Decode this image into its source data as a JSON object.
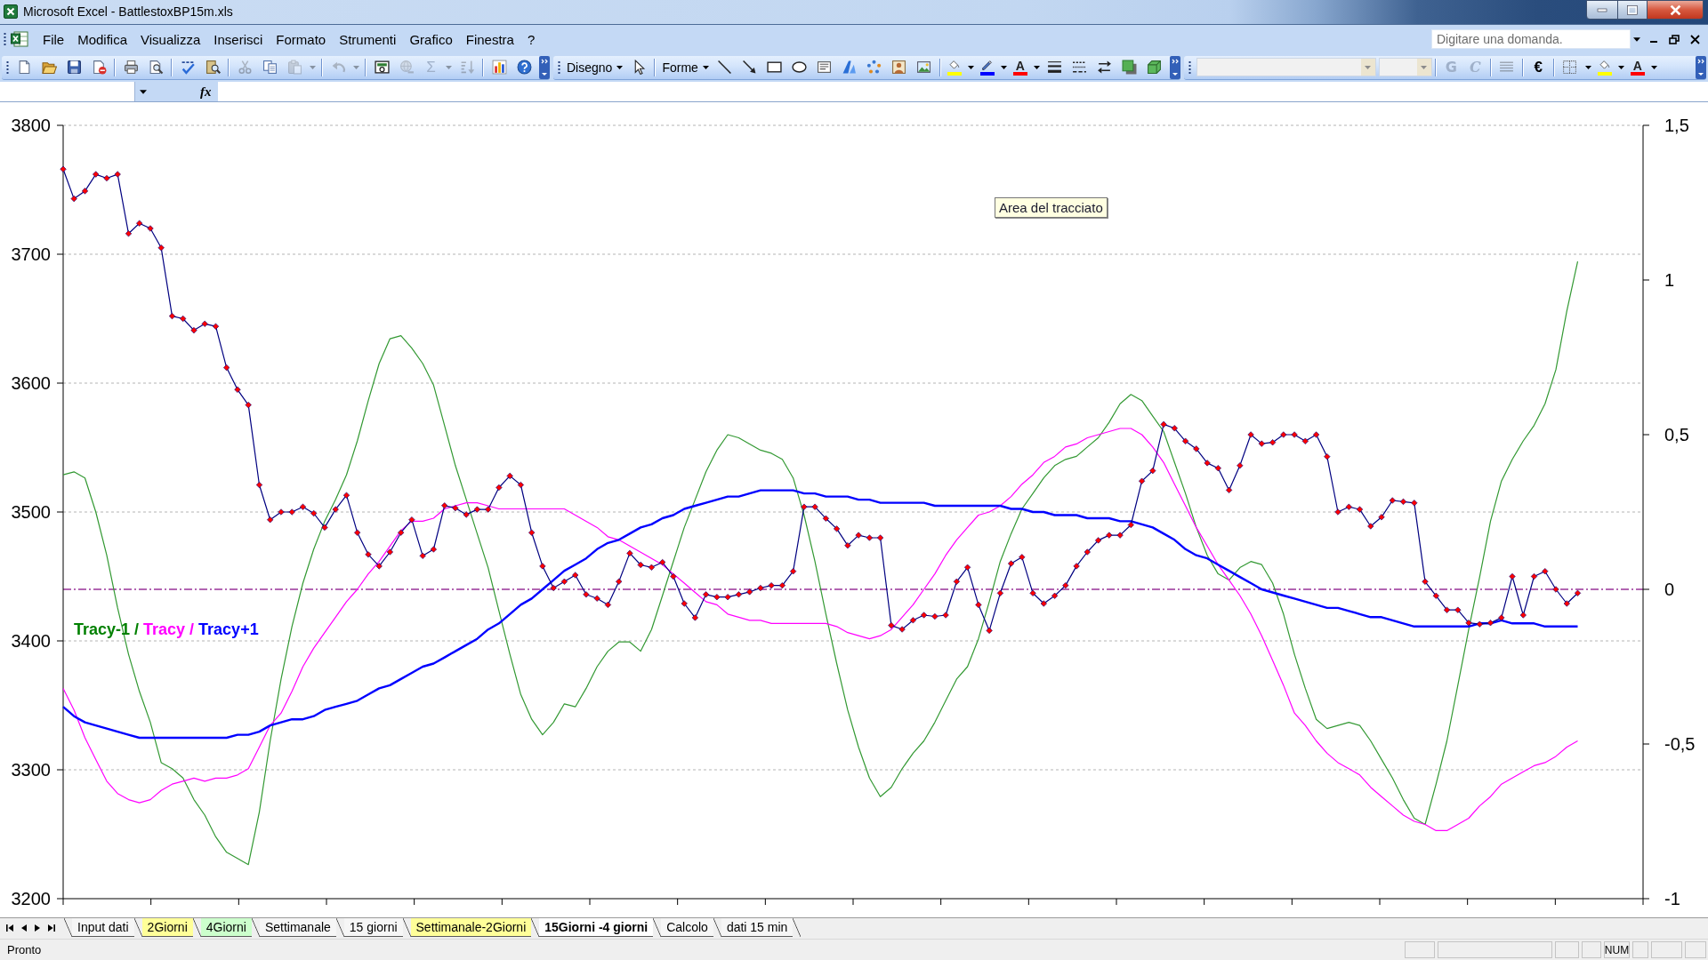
{
  "window": {
    "title": "Microsoft Excel - BattlestoxBP15m.xls"
  },
  "menu_bar": {
    "items": [
      {
        "label": "File"
      },
      {
        "label": "Modifica"
      },
      {
        "label": "Visualizza"
      },
      {
        "label": "Inserisci"
      },
      {
        "label": "Formato"
      },
      {
        "label": "Strumenti"
      },
      {
        "label": "Grafico"
      },
      {
        "label": "Finestra"
      },
      {
        "label": "?"
      }
    ],
    "help_box": {
      "placeholder": "Digitare una domanda."
    }
  },
  "toolbars": [
    {
      "items": [
        {
          "kind": "tool",
          "disabled": false
        },
        {
          "kind": "tool",
          "disabled": false
        },
        {
          "kind": "tool",
          "disabled": false
        },
        {
          "kind": "tool",
          "disabled": false
        },
        {
          "kind": "separator"
        },
        {
          "kind": "tool",
          "disabled": false
        },
        {
          "kind": "tool",
          "disabled": false
        },
        {
          "kind": "separator"
        },
        {
          "kind": "tool",
          "disabled": false
        },
        {
          "kind": "tool",
          "disabled": false
        },
        {
          "kind": "separator"
        },
        {
          "kind": "tool",
          "disabled": true
        },
        {
          "kind": "tool",
          "disabled": false
        },
        {
          "kind": "tool",
          "disabled": true
        },
        {
          "kind": "caret",
          "disabled": true
        },
        {
          "kind": "separator"
        },
        {
          "kind": "tool",
          "disabled": true
        },
        {
          "kind": "caret",
          "disabled": true
        },
        {
          "kind": "separator"
        },
        {
          "kind": "tool",
          "disabled": false
        },
        {
          "kind": "tool",
          "disabled": true
        },
        {
          "kind": "glyph",
          "text": "Σ",
          "disabled": true
        },
        {
          "kind": "caret",
          "disabled": true
        },
        {
          "kind": "tool",
          "disabled": true
        },
        {
          "kind": "separator"
        },
        {
          "kind": "tool",
          "disabled": false
        },
        {
          "kind": "tool",
          "disabled": false
        }
      ]
    },
    {
      "items": [
        {
          "kind": "menu",
          "label": "Disegno"
        },
        {
          "kind": "tool",
          "disabled": false
        },
        {
          "kind": "separator"
        },
        {
          "kind": "menu",
          "label": "Forme"
        },
        {
          "kind": "tool",
          "disabled": false
        },
        {
          "kind": "tool",
          "disabled": false
        },
        {
          "kind": "tool",
          "disabled": false
        },
        {
          "kind": "tool",
          "disabled": false
        },
        {
          "kind": "tool",
          "disabled": false
        },
        {
          "kind": "tool",
          "disabled": false
        },
        {
          "kind": "tool",
          "disabled": false
        },
        {
          "kind": "tool",
          "disabled": false
        },
        {
          "kind": "tool",
          "disabled": false
        },
        {
          "kind": "separator"
        },
        {
          "kind": "color-tool",
          "color": "#ffff00",
          "disabled": false
        },
        {
          "kind": "caret",
          "disabled": false
        },
        {
          "kind": "color-tool",
          "color": "#0000ff",
          "disabled": false
        },
        {
          "kind": "caret",
          "disabled": false
        },
        {
          "kind": "letter-tool",
          "text": "A",
          "color": "#ff0000",
          "disabled": false
        },
        {
          "kind": "caret",
          "disabled": false
        },
        {
          "kind": "tool",
          "disabled": false
        },
        {
          "kind": "tool",
          "disabled": false
        },
        {
          "kind": "tool",
          "disabled": false
        },
        {
          "kind": "tool",
          "disabled": false
        },
        {
          "kind": "tool",
          "disabled": false
        }
      ]
    },
    {
      "items": [
        {
          "kind": "field",
          "disabled": true
        },
        {
          "kind": "field",
          "disabled": true
        },
        {
          "kind": "separator"
        },
        {
          "kind": "bold",
          "text": "G",
          "disabled": true
        },
        {
          "kind": "italic",
          "text": "C",
          "disabled": true
        },
        {
          "kind": "separator"
        },
        {
          "kind": "tool",
          "disabled": true
        },
        {
          "kind": "separator"
        },
        {
          "kind": "glyph",
          "text": "€",
          "disabled": false
        },
        {
          "kind": "separator"
        },
        {
          "kind": "tool",
          "disabled": false
        },
        {
          "kind": "caret",
          "disabled": false
        },
        {
          "kind": "color-tool",
          "color": "#ffff00",
          "disabled": false
        },
        {
          "kind": "caret",
          "disabled": false
        },
        {
          "kind": "letter-tool",
          "text": "A",
          "color": "#ff0000",
          "disabled": false
        },
        {
          "kind": "caret",
          "disabled": false
        }
      ]
    }
  ],
  "formula_bar": {
    "function_label": "fx"
  },
  "chart": {
    "tooltip": "Area del tracciato",
    "legend": [
      {
        "text": "Tracy-1 /",
        "color": "#008000"
      },
      {
        "text": "Tracy /",
        "color": "#ff00ff"
      },
      {
        "text": "Tracy+1",
        "color": "#0000ff"
      }
    ],
    "chart_data": {
      "type": "line",
      "grid": "y",
      "ylim": [
        3200,
        3800
      ],
      "yticks": [
        3200,
        3300,
        3400,
        3500,
        3600,
        3700,
        3800
      ],
      "y2lim": [
        -1,
        1.5
      ],
      "y2ticks": [
        {
          "value": -1,
          "label": "-1"
        },
        {
          "value": -0.5,
          "label": "-0,5"
        },
        {
          "value": 0,
          "label": "0"
        },
        {
          "value": 0.5,
          "label": "0,5"
        },
        {
          "value": 1,
          "label": "1"
        },
        {
          "value": 1.5,
          "label": "1,5"
        }
      ],
      "series": [
        {
          "color": "#339933",
          "axis": "y2",
          "values": [
            0.37,
            0.38,
            0.36,
            0.25,
            0.11,
            -0.06,
            -0.21,
            -0.33,
            -0.43,
            -0.56,
            -0.58,
            -0.61,
            -0.68,
            -0.73,
            -0.8,
            -0.85,
            -0.87,
            -0.89,
            -0.72,
            -0.49,
            -0.29,
            -0.12,
            0.02,
            0.13,
            0.22,
            0.29,
            0.37,
            0.48,
            0.61,
            0.73,
            0.81,
            0.82,
            0.78,
            0.73,
            0.66,
            0.53,
            0.4,
            0.29,
            0.18,
            0.07,
            -0.07,
            -0.21,
            -0.34,
            -0.42,
            -0.47,
            -0.43,
            -0.37,
            -0.38,
            -0.32,
            -0.25,
            -0.2,
            -0.17,
            -0.17,
            -0.2,
            -0.13,
            -0.02,
            0.09,
            0.2,
            0.29,
            0.38,
            0.45,
            0.5,
            0.49,
            0.47,
            0.45,
            0.44,
            0.42,
            0.36,
            0.24,
            0.09,
            -0.08,
            -0.24,
            -0.39,
            -0.51,
            -0.61,
            -0.67,
            -0.64,
            -0.58,
            -0.53,
            -0.49,
            -0.43,
            -0.36,
            -0.29,
            -0.25,
            -0.16,
            -0.04,
            0.09,
            0.18,
            0.26,
            0.31,
            0.36,
            0.4,
            0.42,
            0.43,
            0.46,
            0.49,
            0.54,
            0.6,
            0.63,
            0.61,
            0.56,
            0.51,
            0.41,
            0.31,
            0.2,
            0.11,
            0.05,
            0.03,
            0.07,
            0.09,
            0.08,
            0.02,
            -0.08,
            -0.21,
            -0.32,
            -0.42,
            -0.45,
            -0.44,
            -0.43,
            -0.44,
            -0.49,
            -0.55,
            -0.61,
            -0.68,
            -0.74,
            -0.76,
            -0.63,
            -0.49,
            -0.31,
            -0.13,
            0.04,
            0.22,
            0.35,
            0.42,
            0.48,
            0.53,
            0.6,
            0.71,
            0.9,
            1.06,
            null,
            null,
            null,
            null,
            null,
            null
          ]
        },
        {
          "color": "#ff00ff",
          "axis": "y2",
          "values": [
            -0.32,
            -0.39,
            -0.48,
            -0.55,
            -0.62,
            -0.66,
            -0.68,
            -0.69,
            -0.68,
            -0.65,
            -0.63,
            -0.62,
            -0.61,
            -0.62,
            -0.61,
            -0.61,
            -0.6,
            -0.58,
            -0.51,
            -0.44,
            -0.4,
            -0.33,
            -0.25,
            -0.19,
            -0.14,
            -0.09,
            -0.04,
            0.0,
            0.05,
            0.09,
            0.14,
            0.19,
            0.22,
            0.22,
            0.23,
            0.26,
            0.27,
            0.28,
            0.28,
            0.27,
            0.26,
            0.26,
            0.26,
            0.26,
            0.26,
            0.26,
            0.26,
            0.24,
            0.22,
            0.2,
            0.17,
            0.16,
            0.14,
            0.12,
            0.1,
            0.08,
            0.05,
            0.02,
            -0.01,
            -0.04,
            -0.05,
            -0.08,
            -0.09,
            -0.1,
            -0.1,
            -0.11,
            -0.11,
            -0.11,
            -0.11,
            -0.11,
            -0.11,
            -0.12,
            -0.14,
            -0.15,
            -0.16,
            -0.15,
            -0.13,
            -0.09,
            -0.05,
            0.0,
            0.05,
            0.11,
            0.16,
            0.2,
            0.24,
            0.25,
            0.27,
            0.3,
            0.34,
            0.37,
            0.41,
            0.43,
            0.46,
            0.47,
            0.49,
            0.5,
            0.51,
            0.52,
            0.52,
            0.5,
            0.46,
            0.41,
            0.34,
            0.27,
            0.2,
            0.14,
            0.08,
            0.03,
            -0.02,
            -0.08,
            -0.15,
            -0.23,
            -0.31,
            -0.4,
            -0.44,
            -0.49,
            -0.53,
            -0.56,
            -0.58,
            -0.6,
            -0.64,
            -0.67,
            -0.7,
            -0.73,
            -0.75,
            -0.76,
            -0.78,
            -0.78,
            -0.76,
            -0.74,
            -0.7,
            -0.67,
            -0.63,
            -0.61,
            -0.59,
            -0.57,
            -0.56,
            -0.54,
            -0.51,
            -0.49,
            null,
            null,
            null,
            null,
            null,
            null
          ]
        },
        {
          "color": "#0000ff",
          "axis": "y2",
          "values": [
            -0.38,
            -0.41,
            -0.43,
            -0.44,
            -0.45,
            -0.46,
            -0.47,
            -0.48,
            -0.48,
            -0.48,
            -0.48,
            -0.48,
            -0.48,
            -0.48,
            -0.48,
            -0.48,
            -0.47,
            -0.47,
            -0.46,
            -0.44,
            -0.43,
            -0.42,
            -0.42,
            -0.41,
            -0.39,
            -0.38,
            -0.37,
            -0.36,
            -0.34,
            -0.32,
            -0.31,
            -0.29,
            -0.27,
            -0.25,
            -0.24,
            -0.22,
            -0.2,
            -0.18,
            -0.16,
            -0.13,
            -0.11,
            -0.08,
            -0.05,
            -0.03,
            0.0,
            0.03,
            0.06,
            0.08,
            0.1,
            0.13,
            0.15,
            0.16,
            0.18,
            0.2,
            0.21,
            0.23,
            0.24,
            0.26,
            0.27,
            0.28,
            0.29,
            0.3,
            0.3,
            0.31,
            0.32,
            0.32,
            0.32,
            0.32,
            0.31,
            0.31,
            0.3,
            0.3,
            0.3,
            0.29,
            0.29,
            0.28,
            0.28,
            0.28,
            0.28,
            0.28,
            0.27,
            0.27,
            0.27,
            0.27,
            0.27,
            0.27,
            0.27,
            0.26,
            0.26,
            0.25,
            0.25,
            0.24,
            0.24,
            0.24,
            0.23,
            0.23,
            0.23,
            0.22,
            0.22,
            0.21,
            0.2,
            0.18,
            0.16,
            0.13,
            0.11,
            0.1,
            0.08,
            0.06,
            0.04,
            0.02,
            0.0,
            -0.01,
            -0.02,
            -0.03,
            -0.04,
            -0.05,
            -0.06,
            -0.06,
            -0.07,
            -0.08,
            -0.09,
            -0.09,
            -0.1,
            -0.11,
            -0.12,
            -0.12,
            -0.12,
            -0.12,
            -0.12,
            -0.12,
            -0.11,
            -0.11,
            -0.1,
            -0.11,
            -0.11,
            -0.11,
            -0.12,
            -0.12,
            -0.12,
            -0.12,
            null,
            null,
            null,
            null,
            null,
            null
          ]
        },
        {
          "color": "#000080",
          "marker": "diamond",
          "values": [
            3766,
            3743,
            3749,
            3762,
            3759,
            3762,
            3716,
            3724,
            3720,
            3705,
            3652,
            3650,
            3641,
            3646,
            3644,
            3612,
            3595,
            3583,
            3521,
            3494,
            3500,
            3500,
            3504,
            3499,
            3488,
            3502,
            3513,
            3484,
            3467,
            3458,
            3469,
            3484,
            3494,
            3466,
            3471,
            3505,
            3503,
            3498,
            3502,
            3502,
            3519,
            3528,
            3521,
            3484,
            3458,
            3441,
            3446,
            3451,
            3436,
            3433,
            3428,
            3446,
            3468,
            3459,
            3457,
            3461,
            3450,
            3429,
            3418,
            3436,
            3434,
            3434,
            3436,
            3438,
            3441,
            3443,
            3443,
            3454,
            3504,
            3504,
            3495,
            3487,
            3474,
            3482,
            3480,
            3480,
            3412,
            3409,
            3416,
            3420,
            3419,
            3420,
            3446,
            3457,
            3428,
            3408,
            3437,
            3460,
            3465,
            3437,
            3429,
            3435,
            3443,
            3458,
            3469,
            3478,
            3482,
            3482,
            3490,
            3524,
            3532,
            3568,
            3565,
            3555,
            3549,
            3538,
            3534,
            3517,
            3536,
            3560,
            3553,
            3554,
            3560,
            3560,
            3555,
            3560,
            3543,
            3500,
            3504,
            3502,
            3489,
            3496,
            3509,
            3508,
            3507,
            3446,
            3435,
            3424,
            3424,
            3414,
            3413,
            3414,
            3418,
            3450,
            3420,
            3450,
            3454,
            3440,
            3429,
            3437,
            null,
            null,
            null,
            null,
            null,
            null
          ]
        }
      ],
      "ref_lines": [
        {
          "axis": "y2",
          "value": 0
        }
      ]
    }
  },
  "sheet_tabs": [
    {
      "label": "Input dati",
      "selected": false
    },
    {
      "label": "2Giorni",
      "selected": false,
      "color": "#ffff99"
    },
    {
      "label": "4Giorni",
      "selected": false,
      "color": "#ccffcc"
    },
    {
      "label": "Settimanale",
      "selected": false
    },
    {
      "label": "15 giorni",
      "selected": false
    },
    {
      "label": "Settimanale-2Giorni",
      "selected": false,
      "color": "#ffff99"
    },
    {
      "label": "15Giorni -4 giorni",
      "selected": true
    },
    {
      "label": "Calcolo",
      "selected": false
    },
    {
      "label": "dati 15 min",
      "selected": false
    }
  ],
  "status_bar": {
    "text": "Pronto",
    "panels": [
      {
        "kind": "empty"
      },
      {
        "kind": "empty"
      },
      {
        "kind": "empty"
      },
      {
        "kind": "empty"
      },
      {
        "kind": "text",
        "label": "NUM"
      },
      {
        "kind": "empty"
      },
      {
        "kind": "empty"
      },
      {
        "kind": "empty"
      }
    ]
  }
}
